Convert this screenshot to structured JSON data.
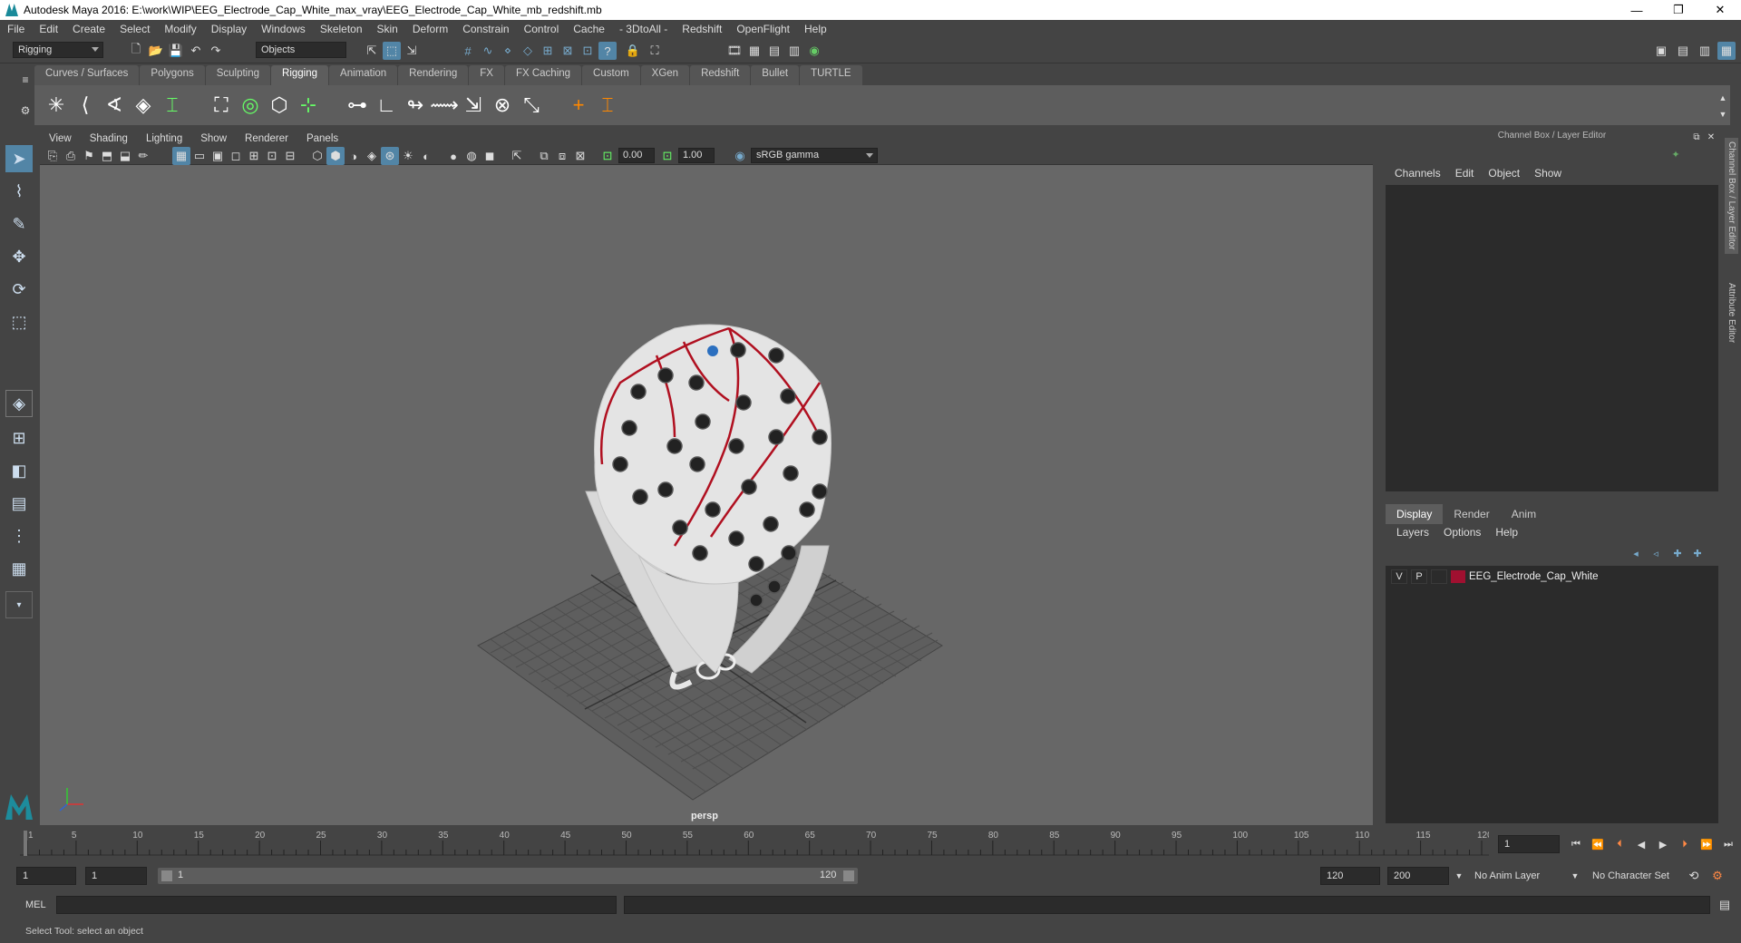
{
  "window": {
    "title": "Autodesk Maya 2016: E:\\work\\WIP\\EEG_Electrode_Cap_White_max_vray\\EEG_Electrode_Cap_White_mb_redshift.mb",
    "minimize": "—",
    "maximize": "❐",
    "close": "✕"
  },
  "menubar": [
    "File",
    "Edit",
    "Create",
    "Select",
    "Modify",
    "Display",
    "Windows",
    "Skeleton",
    "Skin",
    "Deform",
    "Constrain",
    "Control",
    "Cache",
    "- 3DtoAll -",
    "Redshift",
    "OpenFlight",
    "Help"
  ],
  "statusline": {
    "mode": "Rigging",
    "select_mode": "Objects"
  },
  "shelf_tabs": [
    "Curves / Surfaces",
    "Polygons",
    "Sculpting",
    "Rigging",
    "Animation",
    "Rendering",
    "FX",
    "FX Caching",
    "Custom",
    "XGen",
    "Redshift",
    "Bullet",
    "TURTLE"
  ],
  "shelf_active": "Rigging",
  "viewport": {
    "menu": [
      "View",
      "Shading",
      "Lighting",
      "Show",
      "Renderer",
      "Panels"
    ],
    "exposure": "0.00",
    "gamma": "1.00",
    "color_space": "sRGB gamma",
    "camera_label": "persp"
  },
  "right_panel": {
    "title": "Channel Box / Layer Editor",
    "cb_menu": [
      "Channels",
      "Edit",
      "Object",
      "Show"
    ],
    "layer_tabs": [
      "Display",
      "Render",
      "Anim"
    ],
    "layer_active": "Display",
    "layer_menu": [
      "Layers",
      "Options",
      "Help"
    ],
    "layer": {
      "v": "V",
      "p": "P",
      "name": "EEG_Electrode_Cap_White",
      "color": "#a01030"
    },
    "vertical_tabs": [
      "Channel Box / Layer Editor",
      "Attribute Editor"
    ]
  },
  "timeline": {
    "ticks": [
      "1",
      "5",
      "10",
      "15",
      "20",
      "25",
      "30",
      "35",
      "40",
      "45",
      "50",
      "55",
      "60",
      "65",
      "70",
      "75",
      "80",
      "85",
      "90",
      "95",
      "100",
      "105",
      "110",
      "115",
      "120"
    ],
    "current_frame": "1"
  },
  "range": {
    "start": "1",
    "playback_start": "1",
    "slider_start": "1",
    "slider_end": "120",
    "playback_end": "120",
    "end": "200",
    "anim_layer": "No Anim Layer",
    "character_set": "No Character Set"
  },
  "mel": {
    "label": "MEL"
  },
  "help_line": "Select Tool: select an object",
  "colors": {
    "accent": "#5285a6",
    "layer_red": "#a01030",
    "grid_axis_x": "#d33",
    "grid_axis_y": "#3c3",
    "grid_axis_z": "#36c"
  }
}
